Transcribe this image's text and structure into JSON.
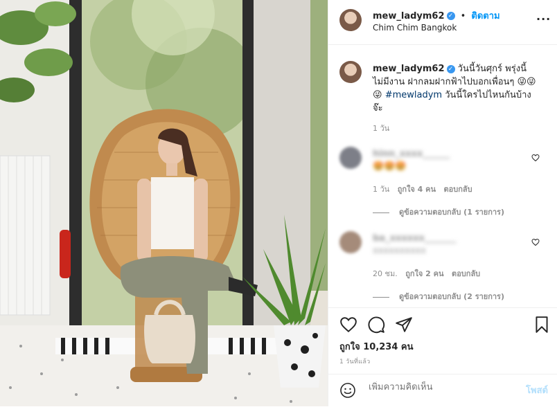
{
  "post": {
    "username": "mew_ladym62",
    "follow_label": "ติดตาม",
    "location": "Chim Chim Bangkok",
    "caption_text": "วันนี้วันศุกร์ พรุ่งนี้ไม่มีงาน ฝากลมฝากฟ้าไปบอกเพื่อนๆ 😜😜😜",
    "hashtag": "#mewladym",
    "caption_tail": "วันนี้ใครไปไหนกันบ้างจ๊ะ",
    "caption_time": "1 วัน"
  },
  "comments": [
    {
      "username": "hinn_xxxx______",
      "text": "🤩🤩🤩",
      "time": "1 วัน",
      "likes": "ถูกใจ 4 คน",
      "reply_label": "ตอบกลับ",
      "view_replies": "ดูข้อความตอบกลับ (1 รายการ)"
    },
    {
      "username": "ba_xxxxxx_______",
      "text": "xxxxxxxxxx",
      "time": "20 ชม.",
      "likes": "ถูกใจ 2 คน",
      "reply_label": "ตอบกลับ",
      "view_replies": "ดูข้อความตอบกลับ (2 รายการ)"
    }
  ],
  "actions": {
    "like_count": "ถูกใจ 10,234 คน",
    "timestamp": "1 วันที่แล้ว",
    "add_comment_placeholder": "เพิ่มความคิดเห็น",
    "post_label": "โพสต์"
  },
  "icons": {
    "more": "more-options-icon",
    "like": "heart-icon",
    "comment": "comment-icon",
    "share": "paper-plane-icon",
    "save": "bookmark-icon",
    "emoji": "emoji-icon"
  },
  "colors": {
    "accent": "#0095f6",
    "verified": "#3897f0",
    "muted": "#8e8e8e",
    "post_disabled": "#b2dffc"
  }
}
